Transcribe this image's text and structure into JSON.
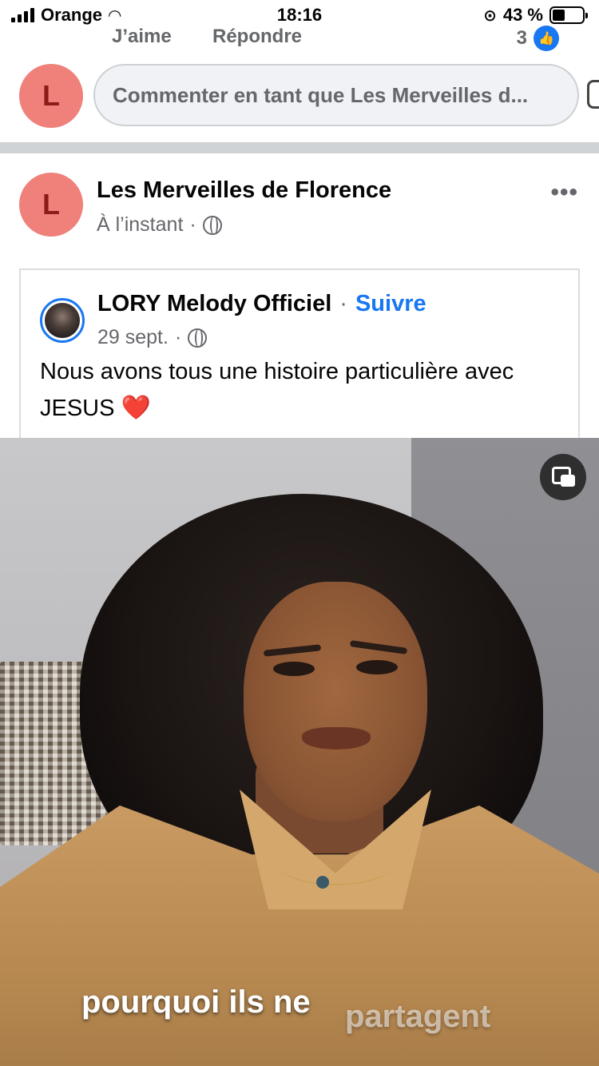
{
  "status_bar": {
    "carrier": "Orange",
    "time": "18:16",
    "battery_pct": "43 %"
  },
  "comment_actions": {
    "like_label": "J’aime",
    "reply_label": "Répondre",
    "reaction_count": "3"
  },
  "comment_box": {
    "avatar_letter": "L",
    "placeholder": "Commenter en tant que Les Merveilles d..."
  },
  "post": {
    "avatar_letter": "L",
    "author": "Les Merveilles de Florence",
    "time": "À l’instant",
    "separator": "·",
    "more_label": "•••",
    "shared": {
      "author": "LORY Melody Officiel",
      "separator": "·",
      "follow_label": "Suivre",
      "date": "29 sept.",
      "text": "Nous avons tous une histoire particulière avec JESUS",
      "emoji": "❤️"
    },
    "video": {
      "subtitle_main": "pourquoi ils ne",
      "subtitle_faded": "partagent"
    }
  },
  "colors": {
    "accent": "#1877f2",
    "avatar_bg": "#ef807a",
    "avatar_fg": "#8b1d18",
    "meta": "#65676b"
  }
}
